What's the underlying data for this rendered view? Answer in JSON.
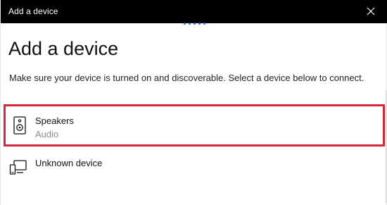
{
  "window": {
    "title": "Add a device"
  },
  "page": {
    "heading": "Add a device",
    "description": "Make sure your device is turned on and discoverable. Select a device below to connect."
  },
  "devices": [
    {
      "name": "Speakers",
      "type": "Audio",
      "icon": "speaker-icon",
      "selected": true
    },
    {
      "name": "Unknown device",
      "type": "",
      "icon": "device-icon",
      "selected": false
    }
  ],
  "colors": {
    "titlebar": "#000000",
    "selection_border": "#d0283a",
    "progress_dots": "#2a6ad6",
    "secondary_text": "#8a8a8a"
  }
}
